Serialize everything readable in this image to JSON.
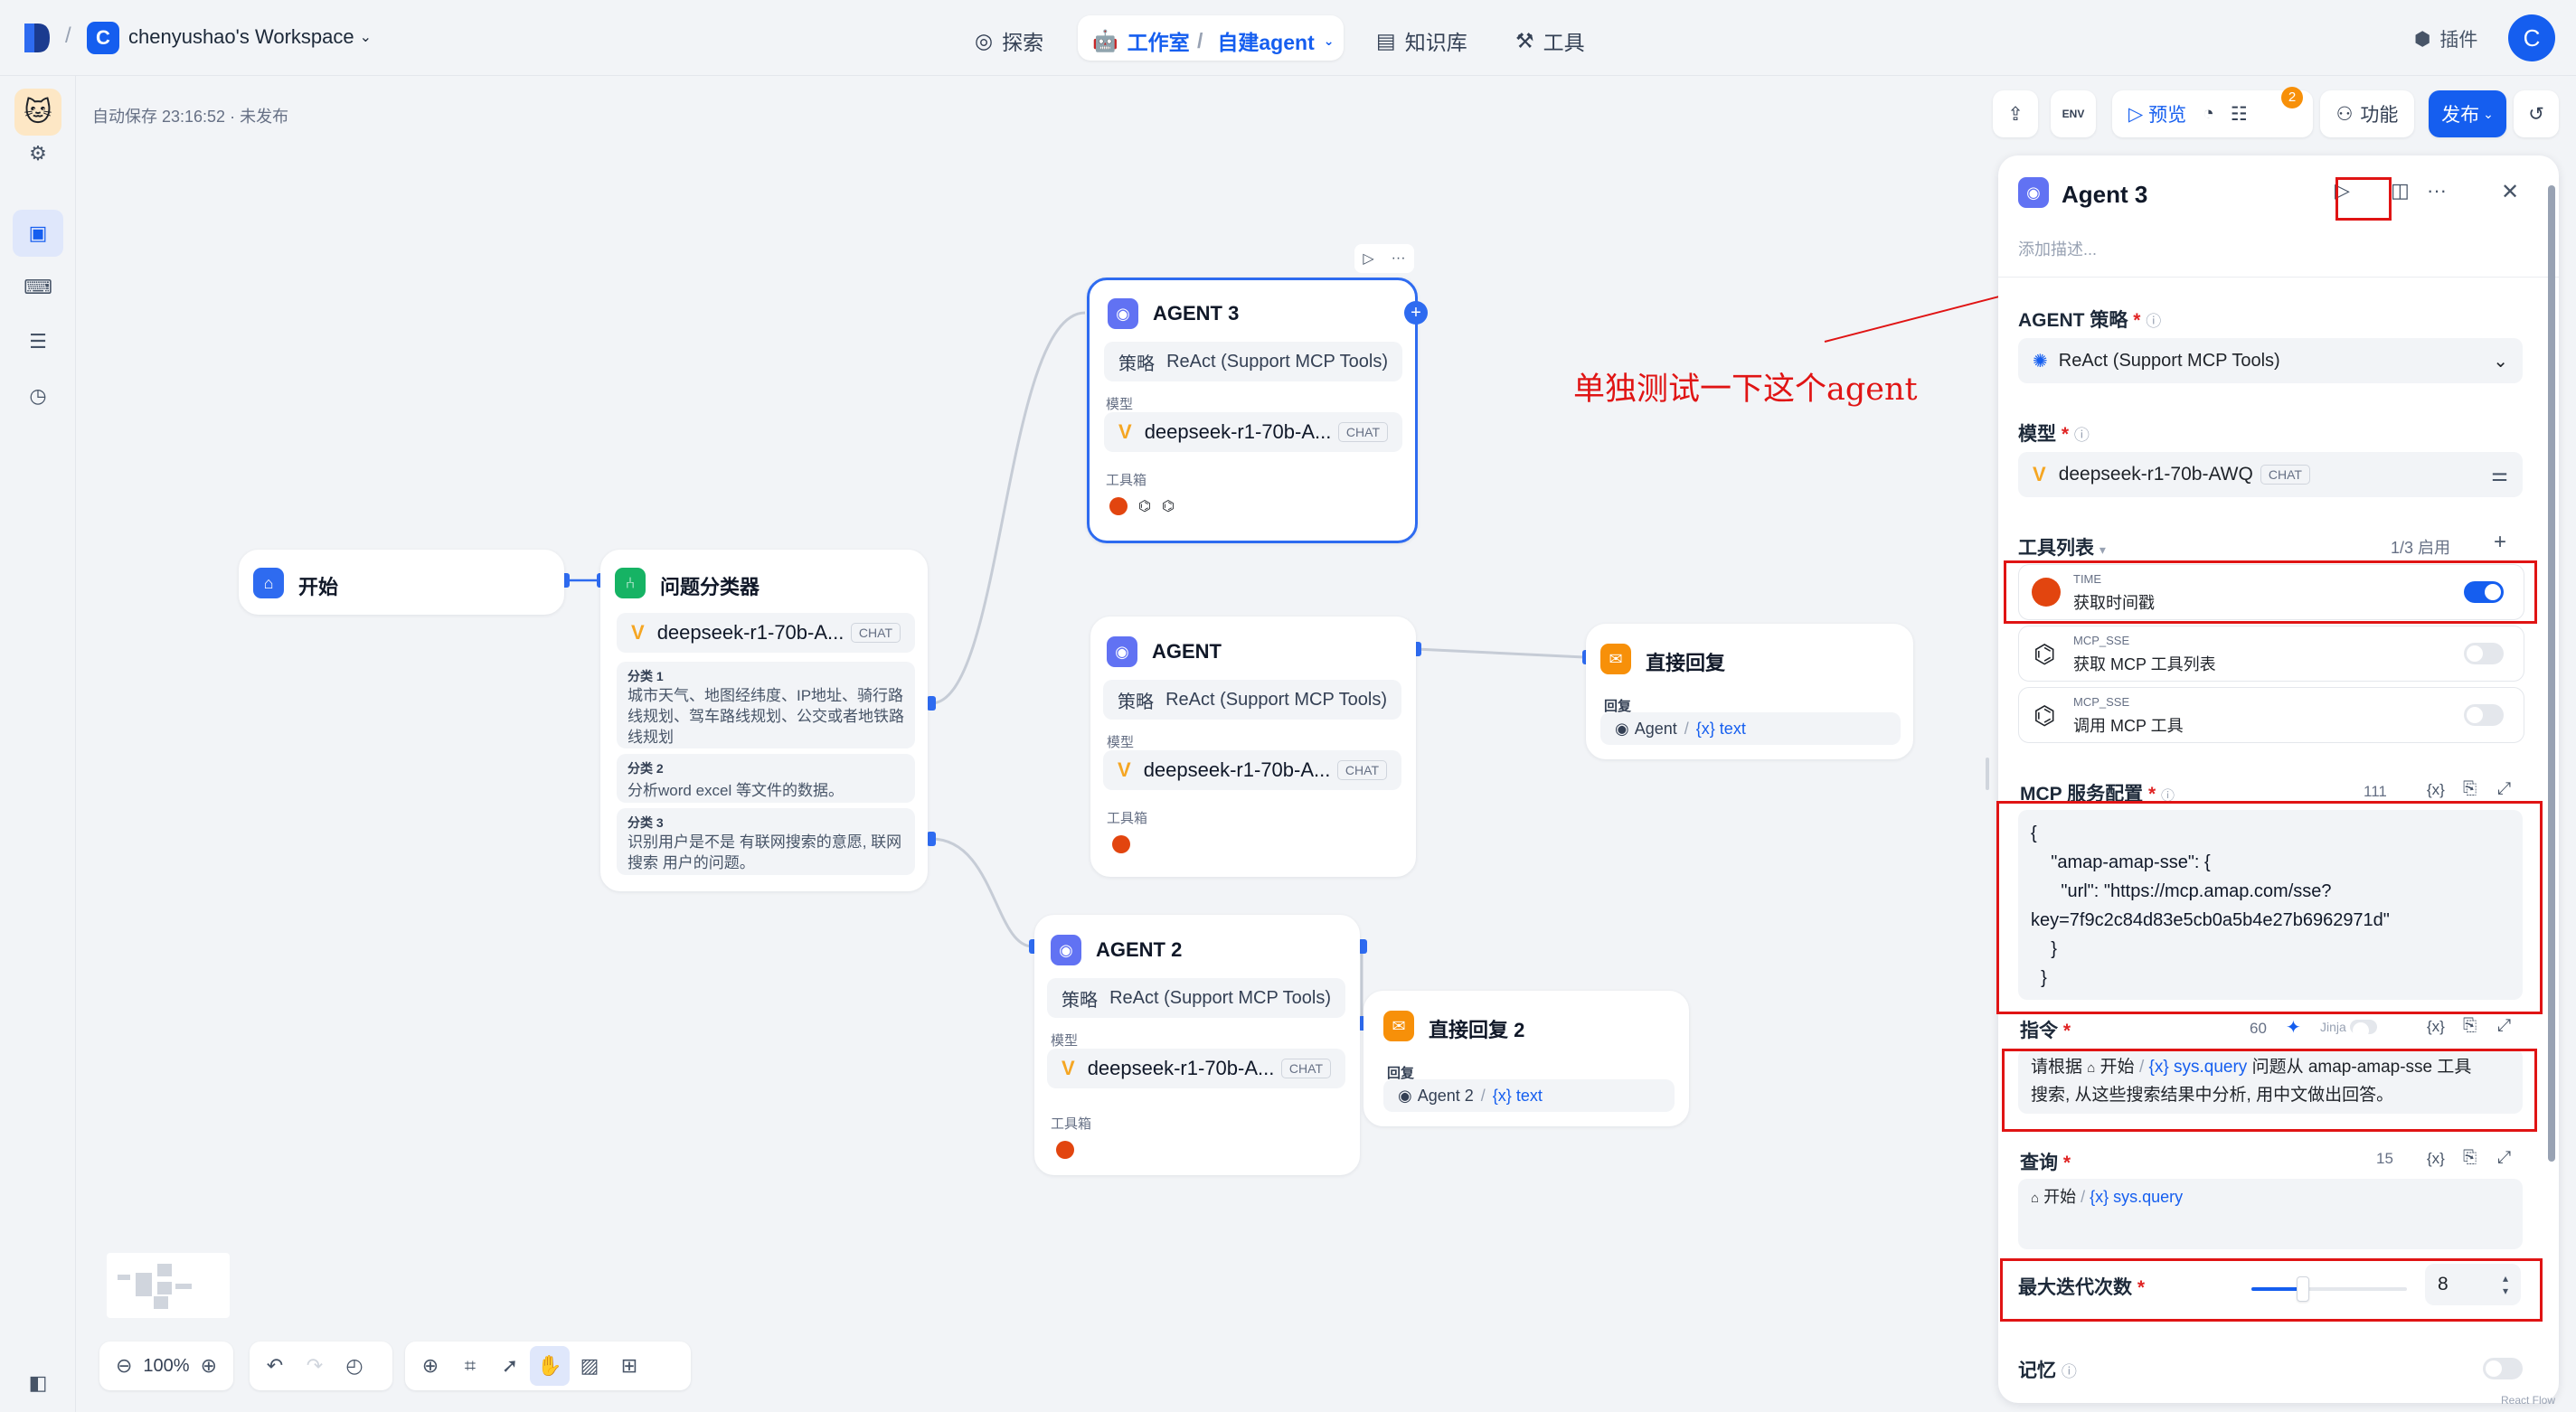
{
  "topbar": {
    "workspace_badge": "C",
    "workspace_name": "chenyushao's Workspace",
    "nav": {
      "explore": "探索",
      "studio": "工作室",
      "app_name": "自建agent",
      "knowledge": "知识库",
      "tools": "工具"
    },
    "plugins": "插件",
    "avatar": "C"
  },
  "canvas": {
    "autosave": "自动保存 23:16:52 · 未发布",
    "toolbar": {
      "preview": "预览",
      "badge_count": "2",
      "features": "功能",
      "publish": "发布",
      "env": "ENV"
    },
    "zoom": "100%"
  },
  "nodes": {
    "start": {
      "title": "开始"
    },
    "classifier": {
      "title": "问题分类器",
      "model": "deepseek-r1-70b-A...",
      "chat": "CHAT",
      "classes": [
        {
          "label": "分类 1",
          "text": "城市天气、地图经纬度、IP地址、骑行路线规划、驾车路线规划、公交或者地铁路线规划"
        },
        {
          "label": "分类 2",
          "text": "分析word excel 等文件的数据。"
        },
        {
          "label": "分类 3",
          "text": "识别用户是不是 有联网搜索的意愿, 联网搜索 用户的问题。"
        }
      ]
    },
    "agent3": {
      "title": "AGENT 3",
      "strategy_label": "策略",
      "strategy": "ReAct (Support MCP Tools)",
      "model_label": "模型",
      "model": "deepseek-r1-70b-A...",
      "chat": "CHAT",
      "tools_label": "工具箱"
    },
    "agent": {
      "title": "AGENT",
      "strategy_label": "策略",
      "strategy": "ReAct (Support MCP Tools)",
      "model_label": "模型",
      "model": "deepseek-r1-70b-A...",
      "chat": "CHAT",
      "tools_label": "工具箱"
    },
    "agent2": {
      "title": "AGENT 2",
      "strategy_label": "策略",
      "strategy": "ReAct (Support MCP Tools)",
      "model_label": "模型",
      "model": "deepseek-r1-70b-A...",
      "chat": "CHAT",
      "tools_label": "工具箱"
    },
    "reply1": {
      "title": "直接回复",
      "reply_label": "回复",
      "src": "Agent",
      "var": "{x} text"
    },
    "reply2": {
      "title": "直接回复 2",
      "reply_label": "回复",
      "src": "Agent 2",
      "var": "{x} text"
    }
  },
  "panel": {
    "title": "Agent 3",
    "desc_placeholder": "添加描述...",
    "strategy_label": "AGENT 策略",
    "strategy_value": "ReAct (Support MCP Tools)",
    "model_label": "模型",
    "model_value": "deepseek-r1-70b-AWQ",
    "model_chat": "CHAT",
    "tools_label": "工具列表",
    "tools_enabled": "1/3 启用",
    "tools": [
      {
        "provider": "TIME",
        "name": "获取时间戳",
        "enabled": true
      },
      {
        "provider": "MCP_SSE",
        "name": "获取 MCP 工具列表",
        "enabled": false
      },
      {
        "provider": "MCP_SSE",
        "name": "调用 MCP 工具",
        "enabled": false
      }
    ],
    "mcp_label": "MCP 服务配置",
    "mcp_count": "111",
    "mcp_code": [
      "{",
      "    \"amap-amap-sse\": {",
      "      \"url\": \"https://mcp.amap.com/sse?",
      "key=7f9c2c84d83e5cb0a5b4e27b6962971d\"",
      "    }",
      "  }"
    ],
    "instruction_label": "指令",
    "instruction_count": "60",
    "jinja": "Jinja",
    "instruction": {
      "p1": "请根据",
      "src": "开始",
      "var": "{x} sys.query",
      "p2": "问题从 amap-amap-sse 工具",
      "line2": "搜索, 从这些搜索结果中分析, 用中文做出回答。"
    },
    "query_label": "查询",
    "query_count": "15",
    "query": {
      "src": "开始",
      "var": "{x} sys.query"
    },
    "max_iter_label": "最大迭代次数",
    "max_iter_value": "8",
    "max_iter_fraction": 0.33,
    "memory_label": "记忆",
    "var_icon": "{x}"
  },
  "annotation": {
    "text": "单独测试一下这个agent",
    "color": "#e01414"
  },
  "footer": {
    "text": "React Flow"
  }
}
